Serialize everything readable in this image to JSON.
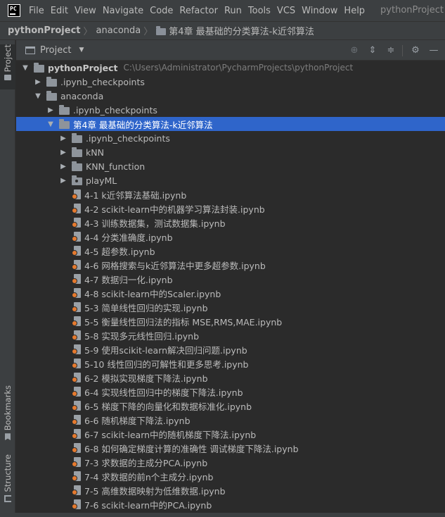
{
  "menubar": {
    "logo": "PC",
    "items": [
      "File",
      "Edit",
      "View",
      "Navigate",
      "Code",
      "Refactor",
      "Run",
      "Tools",
      "VCS",
      "Window",
      "Help"
    ],
    "window_title": "pythonProject"
  },
  "breadcrumb": [
    "pythonProject",
    "anaconda",
    "第4章 最基础的分类算法-k近邻算法"
  ],
  "left_strip": {
    "project": "Project",
    "bookmarks": "Bookmarks",
    "structure": "Structure"
  },
  "panel": {
    "title": "Project",
    "tools": [
      "locate-icon",
      "expand-all-icon",
      "collapse-all-icon",
      "gear-icon",
      "minimize-icon"
    ]
  },
  "tree": [
    {
      "depth": 0,
      "type": "folder",
      "state": "open",
      "label": "pythonProject",
      "hint": "C:\\Users\\Administrator\\PycharmProjects\\pythonProject",
      "bold": true
    },
    {
      "depth": 1,
      "type": "folder",
      "state": "closed",
      "label": ".ipynb_checkpoints"
    },
    {
      "depth": 1,
      "type": "folder",
      "state": "open",
      "label": "anaconda"
    },
    {
      "depth": 2,
      "type": "folder",
      "state": "closed",
      "label": ".ipynb_checkpoints"
    },
    {
      "depth": 2,
      "type": "folder",
      "state": "open",
      "label": "第4章 最基础的分类算法-k近邻算法",
      "selected": true
    },
    {
      "depth": 3,
      "type": "folder",
      "state": "closed",
      "label": ".ipynb_checkpoints"
    },
    {
      "depth": 3,
      "type": "folder",
      "state": "closed",
      "label": "kNN"
    },
    {
      "depth": 3,
      "type": "folder",
      "state": "closed",
      "label": "KNN_function"
    },
    {
      "depth": 3,
      "type": "package",
      "state": "closed",
      "label": "playML"
    },
    {
      "depth": 3,
      "type": "notebook",
      "label": "4-1 k近邻算法基础.ipynb"
    },
    {
      "depth": 3,
      "type": "notebook",
      "label": "4-2 scikit-learn中的机器学习算法封装.ipynb"
    },
    {
      "depth": 3,
      "type": "notebook",
      "label": "4-3 训练数据集，测试数据集.ipynb"
    },
    {
      "depth": 3,
      "type": "notebook",
      "label": "4-4 分类准确度.ipynb"
    },
    {
      "depth": 3,
      "type": "notebook",
      "label": "4-5 超参数.ipynb"
    },
    {
      "depth": 3,
      "type": "notebook",
      "label": "4-6 网格搜索与k近邻算法中更多超参数.ipynb"
    },
    {
      "depth": 3,
      "type": "notebook",
      "label": "4-7 数据归一化.ipynb"
    },
    {
      "depth": 3,
      "type": "notebook",
      "label": "4-8 scikit-learn中的Scaler.ipynb"
    },
    {
      "depth": 3,
      "type": "notebook",
      "label": "5-3 简单线性回归的实现.ipynb"
    },
    {
      "depth": 3,
      "type": "notebook",
      "label": "5-5 衡量线性回归法的指标 MSE,RMS,MAE.ipynb"
    },
    {
      "depth": 3,
      "type": "notebook",
      "label": "5-8 实现多元线性回归.ipynb"
    },
    {
      "depth": 3,
      "type": "notebook",
      "label": "5-9 使用scikit-learn解决回归问题.ipynb"
    },
    {
      "depth": 3,
      "type": "notebook",
      "label": "5-10 线性回归的可解性和更多思考.ipynb"
    },
    {
      "depth": 3,
      "type": "notebook",
      "label": "6-2 模拟实现梯度下降法.ipynb"
    },
    {
      "depth": 3,
      "type": "notebook",
      "label": "6-4 实现线性回归中的梯度下降法.ipynb"
    },
    {
      "depth": 3,
      "type": "notebook",
      "label": "6-5 梯度下降的向量化和数据标准化.ipynb"
    },
    {
      "depth": 3,
      "type": "notebook",
      "label": "6-6 随机梯度下降法.ipynb"
    },
    {
      "depth": 3,
      "type": "notebook",
      "label": "6-7 scikit-learn中的随机梯度下降法.ipynb"
    },
    {
      "depth": 3,
      "type": "notebook",
      "label": "6-8 如何确定梯度计算的准确性 调试梯度下降法.ipynb"
    },
    {
      "depth": 3,
      "type": "notebook",
      "label": "7-3 求数据的主成分PCA.ipynb"
    },
    {
      "depth": 3,
      "type": "notebook",
      "label": "7-4 求数据的前n个主成分.ipynb"
    },
    {
      "depth": 3,
      "type": "notebook",
      "label": "7-5 高维数据映射为低维数据.ipynb"
    },
    {
      "depth": 3,
      "type": "notebook",
      "label": "7-6 scikit-learn中的PCA.ipynb"
    }
  ],
  "colors": {
    "selection": "#2f65ca",
    "notebook_badge": "#e57a2f",
    "background": "#2b2b2b",
    "chrome": "#3c3f41"
  }
}
